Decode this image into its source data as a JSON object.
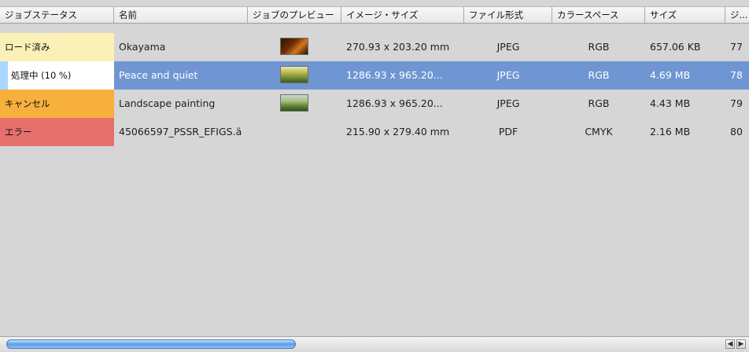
{
  "headers": {
    "status": "ジョブステータス",
    "name": "名前",
    "preview": "ジョブのプレビュー",
    "image_size": "イメージ・サイズ",
    "file_format": "ファイル形式",
    "color_space": "カラースペース",
    "size": "サイズ",
    "more": "ジ..."
  },
  "rows": [
    {
      "status": "ロード済み",
      "name": "Okayama",
      "preview_icon": "photo-thumbnail-icon",
      "image_size": "270.93 x 203.20 mm",
      "file_format": "JPEG",
      "color_space": "RGB",
      "size": "657.06 KB",
      "more": "77"
    },
    {
      "status": "処理中 (10 %)",
      "name": "Peace and quiet",
      "preview_icon": "photo-thumbnail-icon",
      "image_size": "1286.93 x 965.20...",
      "file_format": "JPEG",
      "color_space": "RGB",
      "size": "4.69 MB",
      "more": "78",
      "progress": 0.1
    },
    {
      "status": "キャンセル",
      "name": "Landscape painting",
      "preview_icon": "photo-thumbnail-icon",
      "image_size": "1286.93 x 965.20...",
      "file_format": "JPEG",
      "color_space": "RGB",
      "size": "4.43 MB",
      "more": "79"
    },
    {
      "status": "エラー",
      "name": "45066597_PSSR_EFIGS.ä",
      "preview_icon": "",
      "image_size": "215.90 x 279.40 mm",
      "file_format": "PDF",
      "color_space": "CMYK",
      "size": "2.16 MB",
      "more": "80"
    }
  ],
  "colors": {
    "loaded": "#fbf0b6",
    "processing": "#ffffff",
    "progress_fill": "#a9d7ff",
    "cancel": "#f7b03c",
    "error": "#e5706c",
    "selected_row": "#6f96d2"
  },
  "scroll": {
    "left_arrow": "◀",
    "right_arrow": "▶"
  }
}
